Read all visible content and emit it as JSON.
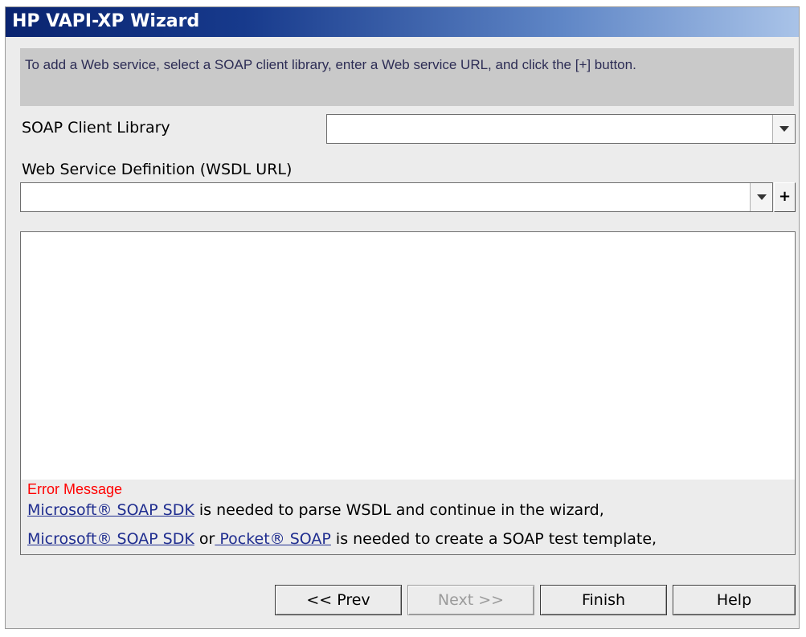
{
  "window": {
    "title": "HP VAPI-XP Wizard"
  },
  "instructions": "To add a Web service, select a SOAP client library, enter a Web service URL, and click the [+] button.",
  "soap_client_library": {
    "label": "SOAP Client Library",
    "value": ""
  },
  "wsdl": {
    "label": "Web Service Definition (WSDL URL)",
    "value": "",
    "add_label": "+"
  },
  "error": {
    "title": "Error Message",
    "line1": {
      "link": "Microsoft® SOAP SDK",
      "text": " is needed to parse WSDL and continue in the wizard,"
    },
    "line2": {
      "link1": "Microsoft® SOAP SDK",
      "or": " or",
      "link2": " Pocket® SOAP",
      "text": " is needed to create a SOAP test template,"
    }
  },
  "buttons": {
    "prev": "<< Prev",
    "next": "Next >>",
    "finish": "Finish",
    "help": "Help"
  }
}
